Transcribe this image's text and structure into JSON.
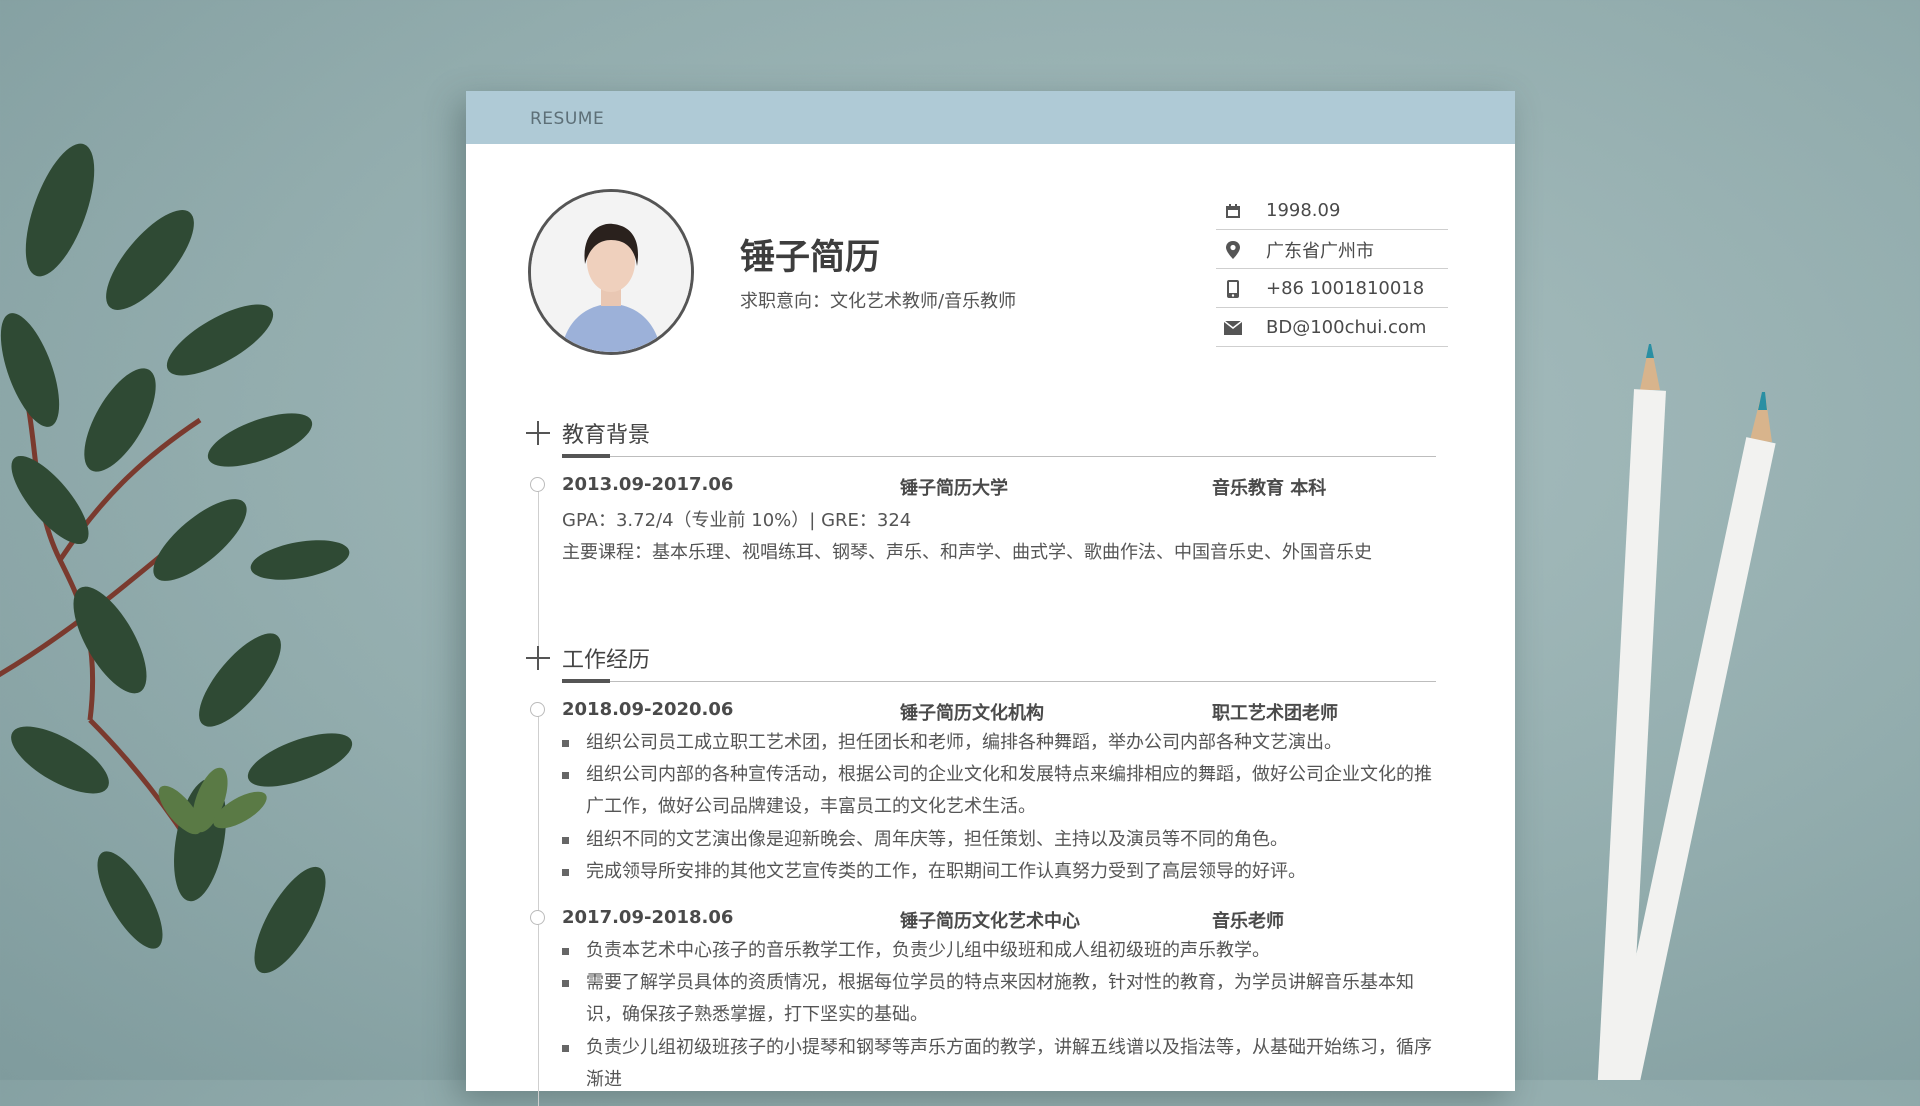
{
  "resume": {
    "header_label": "RESUME",
    "name": "锤子简历",
    "intent": "求职意向：文化艺术教师/音乐教师",
    "contact": [
      {
        "icon": "calendar-icon",
        "text": "1998.09"
      },
      {
        "icon": "location-pin-icon",
        "text": "广东省广州市"
      },
      {
        "icon": "phone-icon",
        "text": "+86 1001810018"
      },
      {
        "icon": "envelope-icon",
        "text": "BD@100chui.com"
      }
    ]
  },
  "education": {
    "title": "教育背景",
    "period": "2013.09-2017.06",
    "school": "锤子简历大学",
    "major": "音乐教育  本科",
    "gpa": "GPA：3.72/4（专业前 10%）| GRE：324",
    "courses": "主要课程：基本乐理、视唱练耳、钢琴、声乐、和声学、曲式学、歌曲作法、中国音乐史、外国音乐史"
  },
  "work": {
    "title": "工作经历",
    "jobs": [
      {
        "period": "2018.09-2020.06",
        "org": "锤子简历文化机构",
        "role": "职工艺术团老师",
        "bullets": [
          "组织公司员工成立职工艺术团，担任团长和老师，编排各种舞蹈，举办公司内部各种文艺演出。",
          "组织公司内部的各种宣传活动，根据公司的企业文化和发展特点来编排相应的舞蹈，做好公司企业文化的推广工作，做好公司品牌建设，丰富员工的文化艺术生活。",
          "组织不同的文艺演出像是迎新晚会、周年庆等，担任策划、主持以及演员等不同的角色。",
          "完成领导所安排的其他文艺宣传类的工作，在职期间工作认真努力受到了高层领导的好评。"
        ]
      },
      {
        "period": "2017.09-2018.06",
        "org": "锤子简历文化艺术中心",
        "role": "音乐老师",
        "bullets": [
          "负责本艺术中心孩子的音乐教学工作，负责少儿组中级班和成人组初级班的声乐教学。",
          "需要了解学员具体的资质情况，根据每位学员的特点来因材施教，针对性的教育，为学员讲解音乐基本知识，确保孩子熟悉掌握，打下坚实的基础。",
          "负责少儿组初级班孩子的小提琴和钢琴等声乐方面的教学，讲解五线谱以及指法等，从基础开始练习，循序渐进"
        ]
      }
    ]
  },
  "colors": {
    "header_bar": "#afcad6",
    "background": "#93adae",
    "text": "#555555"
  }
}
